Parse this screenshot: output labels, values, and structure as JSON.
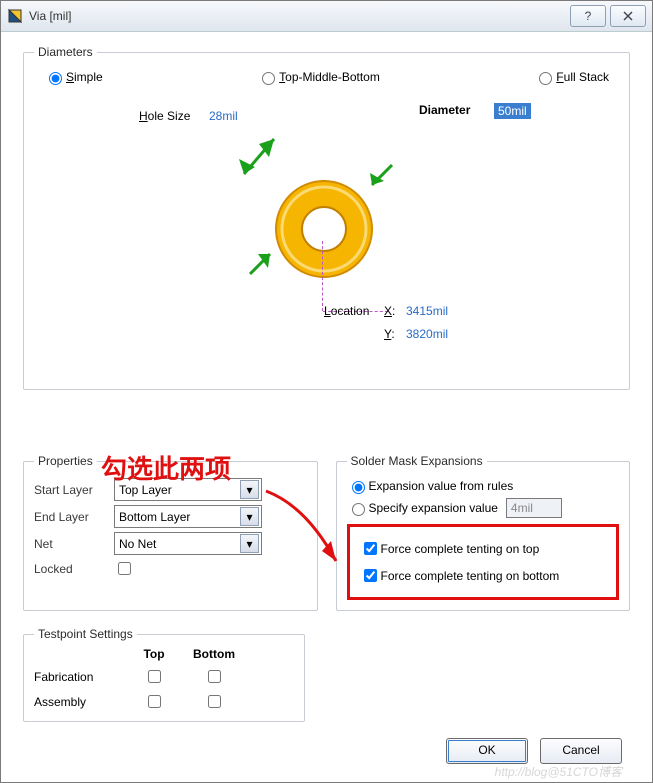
{
  "title": "Via [mil]",
  "diameters": {
    "legend": "Diameters",
    "options": {
      "simple": "Simple",
      "tmb": "Top-Middle-Bottom",
      "full": "Full Stack"
    }
  },
  "holesize": {
    "label": "Hole Size",
    "value": "28mil"
  },
  "diameter": {
    "label": "Diameter",
    "value": "50mil"
  },
  "location": {
    "label": "Location",
    "x_lbl": "X:",
    "y_lbl": "Y:",
    "x": "3415mil",
    "y": "3820mil"
  },
  "annotation": "勾选此两项",
  "properties": {
    "legend": "Properties",
    "start": "Start Layer",
    "start_v": "Top Layer",
    "end": "End Layer",
    "end_v": "Bottom Layer",
    "net": "Net",
    "net_v": "No Net",
    "locked": "Locked"
  },
  "sme": {
    "legend": "Solder Mask Expansions",
    "rules": "Expansion value from rules",
    "specify": "Specify expansion value",
    "val": "4mil",
    "tent_top": "Force complete tenting on top",
    "tent_bot": "Force complete tenting on bottom"
  },
  "tp": {
    "legend": "Testpoint Settings",
    "top": "Top",
    "bottom": "Bottom",
    "fab": "Fabrication",
    "asm": "Assembly"
  },
  "buttons": {
    "ok": "OK",
    "cancel": "Cancel"
  },
  "watermark": "http://blog@51CTO博客"
}
